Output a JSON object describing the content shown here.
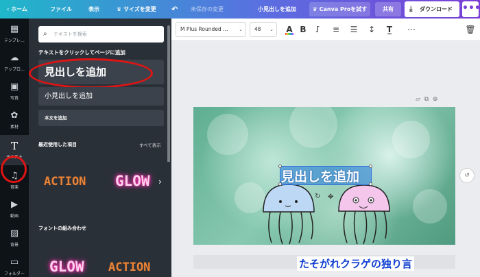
{
  "topbar": {
    "home": "ホーム",
    "file": "ファイル",
    "view": "表示",
    "resize": "サイズを変更",
    "unsaved": "未保存の変更",
    "doc_title": "小見出しを追加",
    "canva_pro": "Canva Proを試す",
    "share": "共有",
    "download": "ダウンロード",
    "more": "•••"
  },
  "rail": {
    "items": [
      {
        "label": "テンプレ…",
        "icon": "layout-icon"
      },
      {
        "label": "アップロ…",
        "icon": "upload-icon"
      },
      {
        "label": "写真",
        "icon": "photo-icon"
      },
      {
        "label": "素材",
        "icon": "elements-icon"
      },
      {
        "label": "テキスト",
        "icon": "text-icon",
        "active": true
      },
      {
        "label": "音楽",
        "icon": "music-icon"
      },
      {
        "label": "動画",
        "icon": "video-icon"
      },
      {
        "label": "背景",
        "icon": "background-icon"
      },
      {
        "label": "フォルダー",
        "icon": "folder-icon"
      }
    ]
  },
  "panel": {
    "search_placeholder": "テキストを検索",
    "hint": "テキストをクリックしてページに追加",
    "add_heading": "見出しを追加",
    "add_subheading": "小見出しを追加",
    "add_body": "本文を追加",
    "recent_title": "最近使用した項目",
    "see_all": "すべて表示",
    "recent_action": "ACTION",
    "recent_glow": "GLOW",
    "combo_title": "フォントの組み合わせ",
    "combo_glow": "GLOW",
    "combo_action": "ACTION"
  },
  "toolbar": {
    "font": "M Plus Rounded …",
    "size": "48"
  },
  "canvas": {
    "selected_text": "見出しを追加"
  },
  "watermark": "たそがれクラゲの独り言",
  "colors": {
    "accent_purple": "#7a3fd6",
    "accent_teal": "#1fb7c9",
    "annotation_red": "#e01414",
    "watermark_blue": "#0f3fd1"
  }
}
